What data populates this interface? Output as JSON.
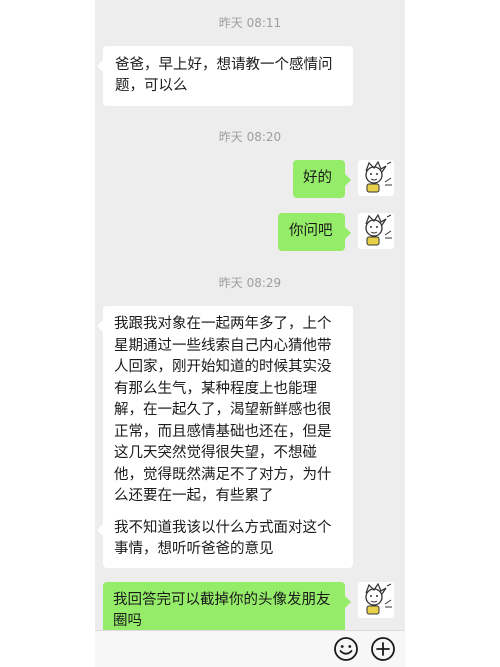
{
  "timestamps": {
    "t1": "昨天 08:11",
    "t2": "昨天 08:20",
    "t3": "昨天 08:29"
  },
  "messages": [
    {
      "side": "left",
      "text": "爸爸，早上好，想请教一个感情问题，可以么"
    },
    {
      "side": "right",
      "text": "好的"
    },
    {
      "side": "right",
      "text": "你问吧"
    },
    {
      "side": "left",
      "text": "我跟我对象在一起两年多了，上个星期通过一些线索自己内心猜他带人回家，刚开始知道的时候其实没有那么生气，某种程度上也能理解，在一起久了，渴望新鲜感也很正常，而且感情基础也还在，但是这几天突然觉得很失望，不想碰他，觉得既然满足不了对方，为什么还要在一起，有些累了"
    },
    {
      "side": "left",
      "text": "我不知道我该以什么方式面对这个事情，想听听爸爸的意见"
    },
    {
      "side": "right",
      "text": "我回答完可以截掉你的头像发朋友圈吗"
    }
  ],
  "icons": {
    "emoji": "smiley-icon",
    "more": "plus-icon"
  },
  "colors": {
    "chat_background": "#ededed",
    "self_bubble": "#95ec69",
    "other_bubble": "#ffffff",
    "timestamp_text": "#9e9e9e"
  }
}
